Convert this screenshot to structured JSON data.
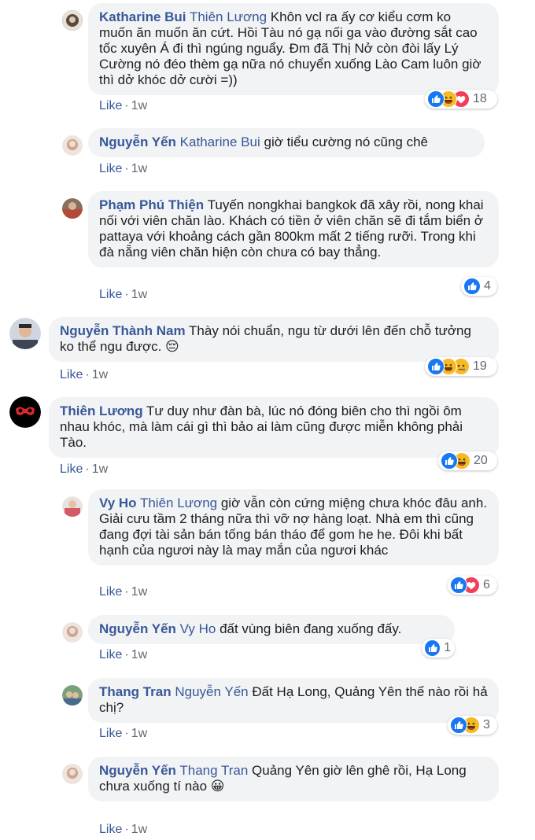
{
  "like_label": "Like",
  "time_label": "1w",
  "comments": [
    {
      "author": "Katharine Bui",
      "tag": "Thiên Lương",
      "text": "Khôn vcl ra ấy cơ kiểu cơm ko muốn ăn muốn ăn cứt. Hồi Tàu nó gạ nối ga vào đường sắt cao tốc xuyên Á đi thì ngúng nguẩy. Đm đã Thị Nở còn đòi lấy Lý Cường nó đéo thèm gạ nữa nó chuyển xuống Lào Cam luôn giờ thì dở khóc dở cười =))",
      "reactions": [
        "like",
        "haha",
        "love"
      ],
      "count": "18"
    },
    {
      "author": "Nguyễn Yến",
      "tag": "Katharine Bui",
      "text": "giờ tiểu cường nó cũng chê",
      "reactions": [],
      "count": ""
    },
    {
      "author": "Phạm Phú Thiện",
      "tag": "",
      "text": "Tuyến nongkhai bangkok đã xây rồi, nong khai nối với viên chăn lào. Khách có tiền ở viên chăn sẽ đi tắm biển ở pattaya với khoảng cách gần 800km mất 2 tiếng rưỡi. Trong khi đà nẵng viên chăn hiện còn chưa có bay thẳng.",
      "reactions": [
        "like"
      ],
      "count": "4"
    },
    {
      "author": "Nguyễn Thành Nam",
      "tag": "",
      "text": "Thày nói chuẩn, ngu từ dưới lên đến chỗ tưởng ko thể ngu được. 😔",
      "reactions": [
        "like",
        "haha",
        "sad"
      ],
      "count": "19"
    },
    {
      "author": "Thiên Lương",
      "tag": "",
      "text": "Tư duy như đàn bà, lúc nó đóng biên cho thì ngồi ôm nhau khóc, mà làm cái gì thì bảo ai làm cũng được miễn không phải Tào.",
      "reactions": [
        "like",
        "haha"
      ],
      "count": "20"
    },
    {
      "author": "Vy Ho",
      "tag": "Thiên Lương",
      "text": "giờ vẫn còn cứng miệng chưa khóc đâu anh. Giải cưu tầm 2 tháng nữa thì vỡ nợ hàng loạt. Nhà em thì cũng đang đợi tài sản bán tống bán tháo để gom he he. Đôi khi bất hạnh của ngươi này là may mắn của ngươi khác",
      "reactions": [
        "like",
        "love"
      ],
      "count": "6"
    },
    {
      "author": "Nguyễn Yến",
      "tag": "Vy Ho",
      "text": "đất vùng biên đang xuống đấy.",
      "reactions": [
        "like"
      ],
      "count": "1"
    },
    {
      "author": "Thang Tran",
      "tag": "Nguyễn Yến",
      "text": "Đất Hạ Long, Quảng Yên thế nào rồi hả chị?",
      "reactions": [
        "like",
        "haha"
      ],
      "count": "3"
    },
    {
      "author": "Nguyễn Yến",
      "tag": "Thang Tran",
      "text": "Quảng Yên giờ lên ghê rồi, Hạ Long chưa xuống tí nào 😀",
      "reactions": [],
      "count": ""
    }
  ]
}
